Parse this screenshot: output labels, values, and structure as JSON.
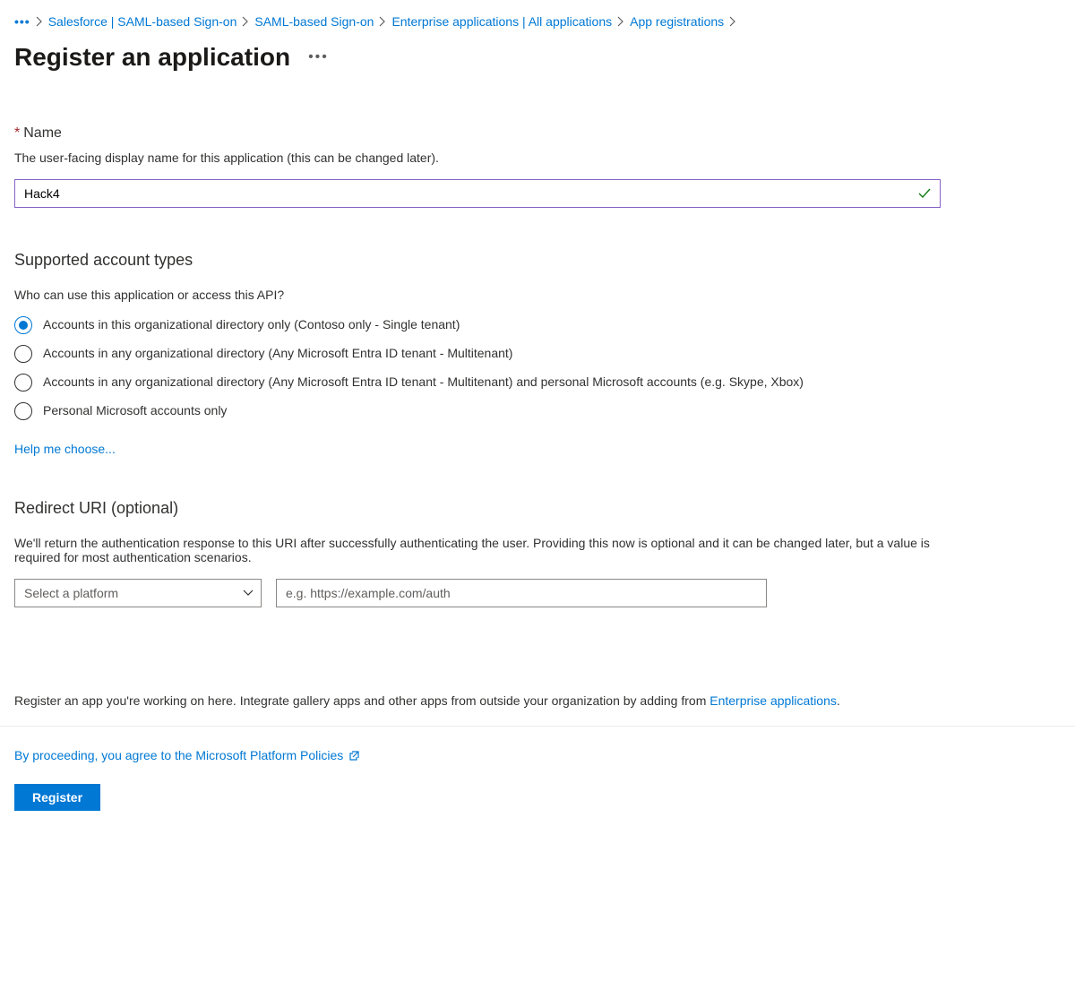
{
  "breadcrumb": {
    "items": [
      "Salesforce | SAML-based Sign-on",
      "SAML-based Sign-on",
      "Enterprise applications | All applications",
      "App registrations"
    ]
  },
  "page": {
    "title": "Register an application"
  },
  "name": {
    "label": "Name",
    "help": "The user-facing display name for this application (this can be changed later).",
    "value": "Hack4"
  },
  "accountTypes": {
    "heading": "Supported account types",
    "question": "Who can use this application or access this API?",
    "options": [
      "Accounts in this organizational directory only (Contoso only - Single tenant)",
      "Accounts in any organizational directory (Any Microsoft Entra ID tenant - Multitenant)",
      "Accounts in any organizational directory (Any Microsoft Entra ID tenant - Multitenant) and personal Microsoft accounts (e.g. Skype, Xbox)",
      "Personal Microsoft accounts only"
    ],
    "helpLink": "Help me choose..."
  },
  "redirect": {
    "heading": "Redirect URI (optional)",
    "help": "We'll return the authentication response to this URI after successfully authenticating the user. Providing this now is optional and it can be changed later, but a value is required for most authentication scenarios.",
    "platformPlaceholder": "Select a platform",
    "uriPlaceholder": "e.g. https://example.com/auth"
  },
  "footer": {
    "textPrefix": "Register an app you're working on here. Integrate gallery apps and other apps from outside your organization by adding from ",
    "linkText": "Enterprise applications",
    "suffix": ".",
    "policies": "By proceeding, you agree to the Microsoft Platform Policies",
    "registerLabel": "Register"
  }
}
